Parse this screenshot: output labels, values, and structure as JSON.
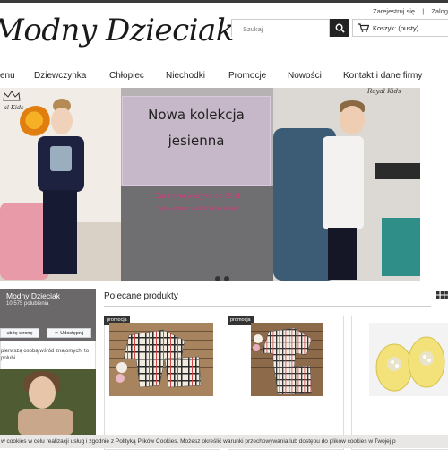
{
  "header": {
    "auth_links": [
      "Zarejestruj się",
      "Zalog"
    ],
    "logo_text": "Modny Dzieciak",
    "search_placeholder": "Szukaj",
    "cart_label": "Koszyk: (pusty)"
  },
  "nav": {
    "items": [
      "enu",
      "Dziewczynka",
      "Chłopiec",
      "Niechodki",
      "Promocje",
      "Nowości",
      "Kontakt i dane firmy"
    ]
  },
  "banner": {
    "headline_1": "Nowa kolekcja",
    "headline_2": "jesienna",
    "shipping": "Darmowa wysyłka od 99 zł",
    "note": "* przy wpłacie na konto kurier inPost",
    "brand_left": "al Kids",
    "brand_right": "Royal Kids",
    "slides": 2
  },
  "sidebar": {
    "page_name": "Modny Dzieciak",
    "likes": "10 575 polubienia",
    "like_button": "ub tę stronę",
    "share_button": "Udostępnij",
    "friends_text": "pierwszą osobą wśród znajomych, to polubi"
  },
  "products": {
    "title": "Polecane produkty",
    "badges": [
      "promocja",
      "promocja"
    ]
  },
  "cookie_bar": {
    "text": "w cookies w celu realizacji usług i zgodnie z Polityką Plików Cookies. Możesz określić warunki przechowywania lub dostępu do plików cookies w Twojej p"
  },
  "colors": {
    "promo_text": "#d63a7a",
    "nav_text": "#222222",
    "header_bar": "#3a3a3a"
  }
}
